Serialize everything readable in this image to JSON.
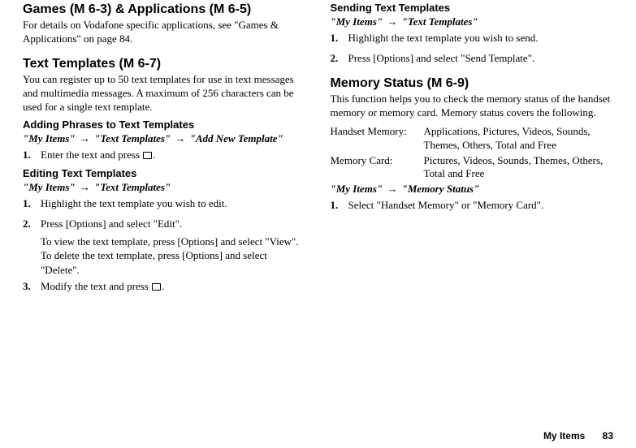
{
  "left": {
    "games_heading": "Games (M 6-3) & Applications (M 6-5)",
    "games_desc": "For details on Vodafone specific applications, see \"Games & Applications\" on page 84.",
    "tt_heading": "Text Templates (M 6-7)",
    "tt_desc": "You can register up to 50 text templates for use in text messages and multimedia messages. A maximum of 256 characters can be used for a single text template.",
    "add_heading": "Adding Phrases to Text Templates",
    "add_path_1": "\"My Items\"",
    "add_path_2": "\"Text Templates\"",
    "add_path_3": "\"Add New Template\"",
    "add_step1_num": "1.",
    "add_step1_a": "Enter the text and press ",
    "add_step1_b": ".",
    "edit_heading": "Editing Text Templates",
    "edit_path_1": "\"My Items\"",
    "edit_path_2": "\"Text Templates\"",
    "edit_step1_num": "1.",
    "edit_step1": "Highlight the text template you wish to edit.",
    "edit_step2_num": "2.",
    "edit_step2": "Press [Options] and select \"Edit\".",
    "edit_step2_sub1": "To view the text template, press [Options] and select \"View\".",
    "edit_step2_sub2": "To delete the text template, press [Options] and select \"Delete\".",
    "edit_step3_num": "3.",
    "edit_step3_a": "Modify the text and press ",
    "edit_step3_b": "."
  },
  "right": {
    "send_heading": "Sending Text Templates",
    "send_path_1": "\"My Items\"",
    "send_path_2": "\"Text Templates\"",
    "send_step1_num": "1.",
    "send_step1": "Highlight the text template you wish to send.",
    "send_step2_num": "2.",
    "send_step2": "Press [Options] and select \"Send Template\".",
    "mem_heading": "Memory Status (M 6-9)",
    "mem_desc": "This function helps you to check the memory status of the handset memory or memory card. Memory status covers the following.",
    "mem_rows": [
      {
        "label": "Handset Memory:",
        "val": "Applications, Pictures, Videos, Sounds, Themes, Others, Total and Free"
      },
      {
        "label": "Memory Card:",
        "val": "Pictures, Videos, Sounds, Themes, Others, Total and Free"
      }
    ],
    "mem_path_1": "\"My Items\"",
    "mem_path_2": "\"Memory Status\"",
    "mem_step1_num": "1.",
    "mem_step1": "Select \"Handset Memory\" or \"Memory Card\"."
  },
  "footer": {
    "section": "My Items",
    "page": "83"
  }
}
